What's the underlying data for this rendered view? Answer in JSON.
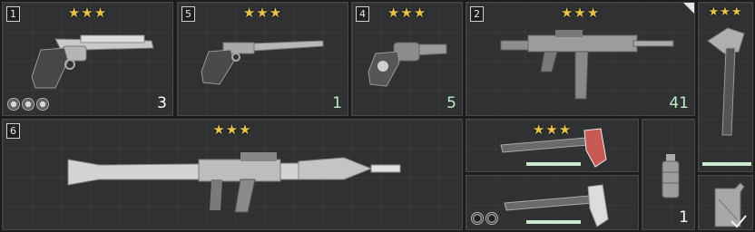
{
  "slots": [
    {
      "num": "1",
      "stars": "★★★",
      "count": "3"
    },
    {
      "num": "5",
      "stars": "★★★",
      "count": "1"
    },
    {
      "num": "4",
      "stars": "★★★",
      "count": "5"
    },
    {
      "num": "2",
      "stars": "★★★",
      "count": "41"
    },
    {
      "stars": "★★★"
    },
    {
      "num": "6",
      "stars": "★★★"
    },
    {
      "stars": "★★★"
    },
    {},
    {
      "count": "1"
    },
    {}
  ],
  "colors": {
    "star": "#e6c34a",
    "count_green": "#bdebc4",
    "durability_bar": "#c9ead2"
  },
  "icons": [
    "magnum-revolver-icon",
    "long-barrel-pistol-icon",
    "snub-revolver-icon",
    "assault-rifle-icon",
    "tomahawk-icon",
    "rocket-launcher-icon",
    "red-axe-icon",
    "axe-icon",
    "grenade-icon",
    "fuel-can-icon"
  ]
}
